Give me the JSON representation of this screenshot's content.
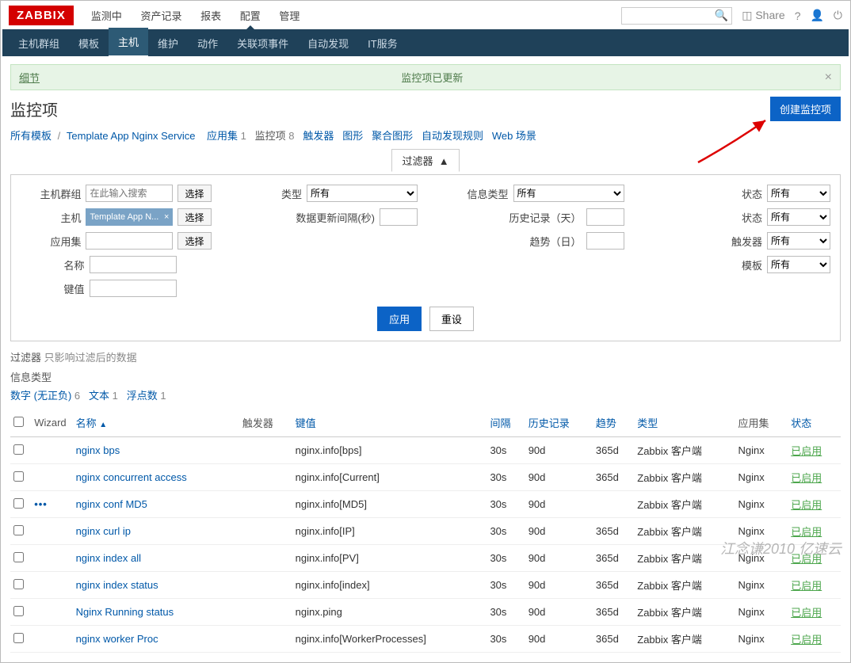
{
  "logo": "ZABBIX",
  "topnav": [
    {
      "label": "监测中",
      "active": false
    },
    {
      "label": "资产记录",
      "active": false
    },
    {
      "label": "报表",
      "active": false
    },
    {
      "label": "配置",
      "active": true
    },
    {
      "label": "管理",
      "active": false
    }
  ],
  "topright": {
    "share": "Share",
    "help_icon": "?",
    "user_icon": "user",
    "power_icon": "power"
  },
  "subnav": [
    {
      "label": "主机群组",
      "active": false
    },
    {
      "label": "模板",
      "active": false
    },
    {
      "label": "主机",
      "active": true
    },
    {
      "label": "维护",
      "active": false
    },
    {
      "label": "动作",
      "active": false
    },
    {
      "label": "关联项事件",
      "active": false
    },
    {
      "label": "自动发现",
      "active": false
    },
    {
      "label": "IT服务",
      "active": false
    }
  ],
  "banner": {
    "left": "细节",
    "center": "监控项已更新"
  },
  "page_title": "监控项",
  "create_btn": "创建监控项",
  "breadcrumb": {
    "all_templates": "所有模板",
    "template_name": "Template App Nginx Service",
    "tabs": [
      {
        "label": "应用集",
        "count": "1",
        "active": false
      },
      {
        "label": "监控项",
        "count": "8",
        "active": true
      },
      {
        "label": "触发器",
        "count": "",
        "active": false
      },
      {
        "label": "图形",
        "count": "",
        "active": false
      },
      {
        "label": "聚合图形",
        "count": "",
        "active": false
      },
      {
        "label": "自动发现规则",
        "count": "",
        "active": false
      },
      {
        "label": "Web 场景",
        "count": "",
        "active": false
      }
    ]
  },
  "filter": {
    "toggle_label": "过滤器",
    "host_group_label": "主机群组",
    "host_group_placeholder": "在此输入搜索",
    "select_btn": "选择",
    "host_label": "主机",
    "host_value": "Template App N...",
    "appset_label": "应用集",
    "name_label": "名称",
    "key_label": "键值",
    "type_label": "类型",
    "type_value": "所有",
    "update_interval_label": "数据更新间隔(秒)",
    "info_type_label": "信息类型",
    "info_type_value": "所有",
    "history_label": "历史记录（天）",
    "trend_label": "趋势（日）",
    "status_label": "状态",
    "status_value": "所有",
    "state_label": "状态",
    "state_value": "所有",
    "trigger_label": "触发器",
    "trigger_value": "所有",
    "template_filter_label": "模板",
    "template_filter_value": "所有",
    "apply": "应用",
    "reset": "重设",
    "subfilter_header": "过滤器 只影响过滤后的数据",
    "subfilter_info_type": "信息类型",
    "subfilter_items": [
      {
        "label": "数字 (无正负)",
        "count": "6"
      },
      {
        "label": "文本",
        "count": "1"
      },
      {
        "label": "浮点数",
        "count": "1"
      }
    ]
  },
  "table": {
    "headers": {
      "wizard": "Wizard",
      "name": "名称",
      "triggers": "触发器",
      "key": "键值",
      "interval": "间隔",
      "history": "历史记录",
      "trend": "趋势",
      "type": "类型",
      "appset": "应用集",
      "status": "状态"
    },
    "rows": [
      {
        "name": "nginx bps",
        "key": "nginx.info[bps]",
        "interval": "30s",
        "history": "90d",
        "trend": "365d",
        "type": "Zabbix 客户端",
        "appset": "Nginx",
        "status": "已启用",
        "wizard": false
      },
      {
        "name": "nginx concurrent access",
        "key": "nginx.info[Current]",
        "interval": "30s",
        "history": "90d",
        "trend": "365d",
        "type": "Zabbix 客户端",
        "appset": "Nginx",
        "status": "已启用",
        "wizard": false
      },
      {
        "name": "nginx conf MD5",
        "key": "nginx.info[MD5]",
        "interval": "30s",
        "history": "90d",
        "trend": "",
        "type": "Zabbix 客户端",
        "appset": "Nginx",
        "status": "已启用",
        "wizard": true
      },
      {
        "name": "nginx curl ip",
        "key": "nginx.info[IP]",
        "interval": "30s",
        "history": "90d",
        "trend": "365d",
        "type": "Zabbix 客户端",
        "appset": "Nginx",
        "status": "已启用",
        "wizard": false
      },
      {
        "name": "nginx index all",
        "key": "nginx.info[PV]",
        "interval": "30s",
        "history": "90d",
        "trend": "365d",
        "type": "Zabbix 客户端",
        "appset": "Nginx",
        "status": "已启用",
        "wizard": false
      },
      {
        "name": "nginx index status",
        "key": "nginx.info[index]",
        "interval": "30s",
        "history": "90d",
        "trend": "365d",
        "type": "Zabbix 客户端",
        "appset": "Nginx",
        "status": "已启用",
        "wizard": false
      },
      {
        "name": "Nginx Running status",
        "key": "nginx.ping",
        "interval": "30s",
        "history": "90d",
        "trend": "365d",
        "type": "Zabbix 客户端",
        "appset": "Nginx",
        "status": "已启用",
        "wizard": false
      },
      {
        "name": "nginx worker Proc",
        "key": "nginx.info[WorkerProcesses]",
        "interval": "30s",
        "history": "90d",
        "trend": "365d",
        "type": "Zabbix 客户端",
        "appset": "Nginx",
        "status": "已启用",
        "wizard": false
      }
    ]
  },
  "watermark": "江念谦2010 亿速云"
}
